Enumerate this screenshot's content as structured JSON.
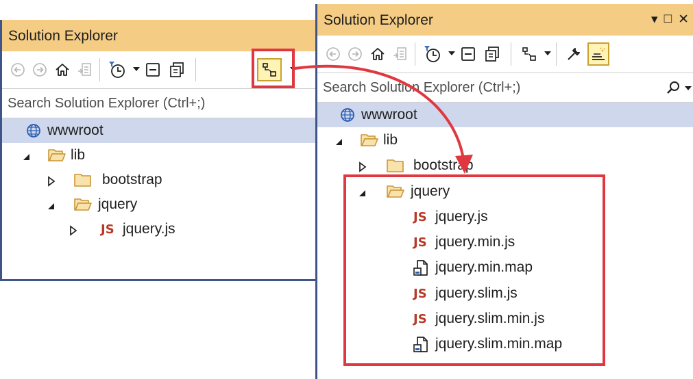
{
  "left_panel": {
    "title": "Solution Explorer",
    "search_placeholder": "Search Solution Explorer (Ctrl+;)",
    "tree": [
      {
        "label": "wwwroot",
        "icon": "globe-icon",
        "selected": true
      },
      {
        "label": "lib",
        "icon": "folder-open-icon",
        "expanded": true
      },
      {
        "label": "bootstrap",
        "icon": "folder-icon",
        "expanded": false
      },
      {
        "label": "jquery",
        "icon": "folder-open-icon",
        "expanded": true
      },
      {
        "label": "jquery.js",
        "icon": "js-icon",
        "expanded": false
      }
    ]
  },
  "right_panel": {
    "title": "Solution Explorer",
    "search_placeholder": "Search Solution Explorer (Ctrl+;)",
    "tree": [
      {
        "label": "wwwroot",
        "icon": "globe-icon",
        "selected": true
      },
      {
        "label": "lib",
        "icon": "folder-open-icon",
        "expanded": true
      },
      {
        "label": "bootstrap",
        "icon": "folder-icon",
        "expanded": false
      },
      {
        "label": "jquery",
        "icon": "folder-open-icon",
        "expanded": true
      },
      {
        "label": "jquery.js",
        "icon": "js-icon"
      },
      {
        "label": "jquery.min.js",
        "icon": "js-icon"
      },
      {
        "label": "jquery.min.map",
        "icon": "map-file-icon"
      },
      {
        "label": "jquery.slim.js",
        "icon": "js-icon"
      },
      {
        "label": "jquery.slim.min.js",
        "icon": "js-icon"
      },
      {
        "label": "jquery.slim.min.map",
        "icon": "map-file-icon"
      }
    ]
  },
  "js_badge": "JS",
  "colors": {
    "title_bar": "#f5cc84",
    "selection": "#cfd7ec",
    "frame": "#3f5587",
    "highlight": "#e03840",
    "js_text": "#b83a26",
    "folder": "#d9a648"
  }
}
